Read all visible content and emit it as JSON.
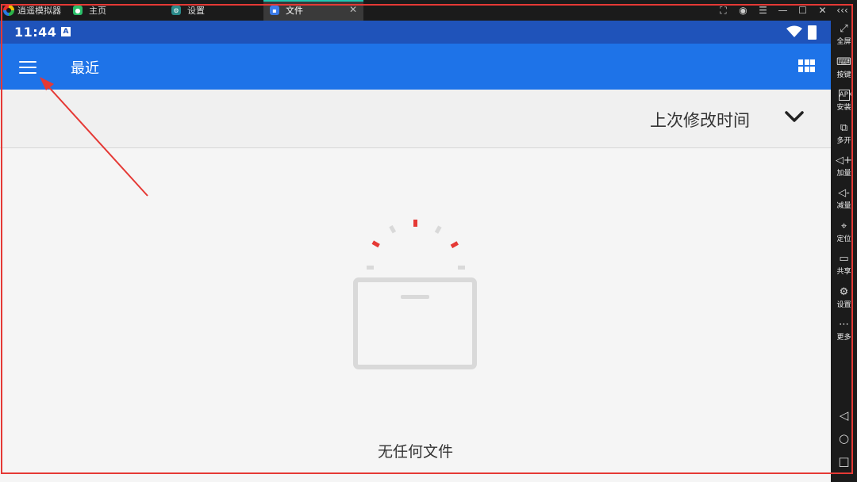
{
  "window": {
    "app_name": "逍遥模拟器",
    "tabs": [
      {
        "label": "主页",
        "active": false
      },
      {
        "label": "设置",
        "active": false
      },
      {
        "label": "文件",
        "active": true
      }
    ],
    "controls": [
      "screenshot-icon",
      "account-icon",
      "menu-icon",
      "minimize-icon",
      "maximize-icon",
      "close-icon",
      "collapse-icon"
    ]
  },
  "sidebar": {
    "items": [
      {
        "label": "全屏",
        "icon": "fullscreen-icon"
      },
      {
        "label": "按键",
        "icon": "keyboard-icon"
      },
      {
        "label": "安装",
        "icon": "apk-install-icon"
      },
      {
        "label": "多开",
        "icon": "multi-instance-icon"
      },
      {
        "label": "加量",
        "icon": "volume-up-icon"
      },
      {
        "label": "减量",
        "icon": "volume-down-icon"
      },
      {
        "label": "定位",
        "icon": "location-icon"
      },
      {
        "label": "共享",
        "icon": "folder-icon"
      },
      {
        "label": "设置",
        "icon": "gear-icon"
      },
      {
        "label": "更多",
        "icon": "more-icon"
      }
    ],
    "nav": [
      "back-icon",
      "home-icon",
      "recents-icon"
    ]
  },
  "statusbar": {
    "time": "11:44",
    "notification": "A"
  },
  "appbar": {
    "title": "最近"
  },
  "sort": {
    "label": "上次修改时间"
  },
  "empty_state": {
    "text": "无任何文件"
  },
  "colors": {
    "statusbar": "#1f53ba",
    "appbar": "#1e73e8",
    "annotation": "#e53935",
    "tab_accent": "#1ec9b6"
  }
}
